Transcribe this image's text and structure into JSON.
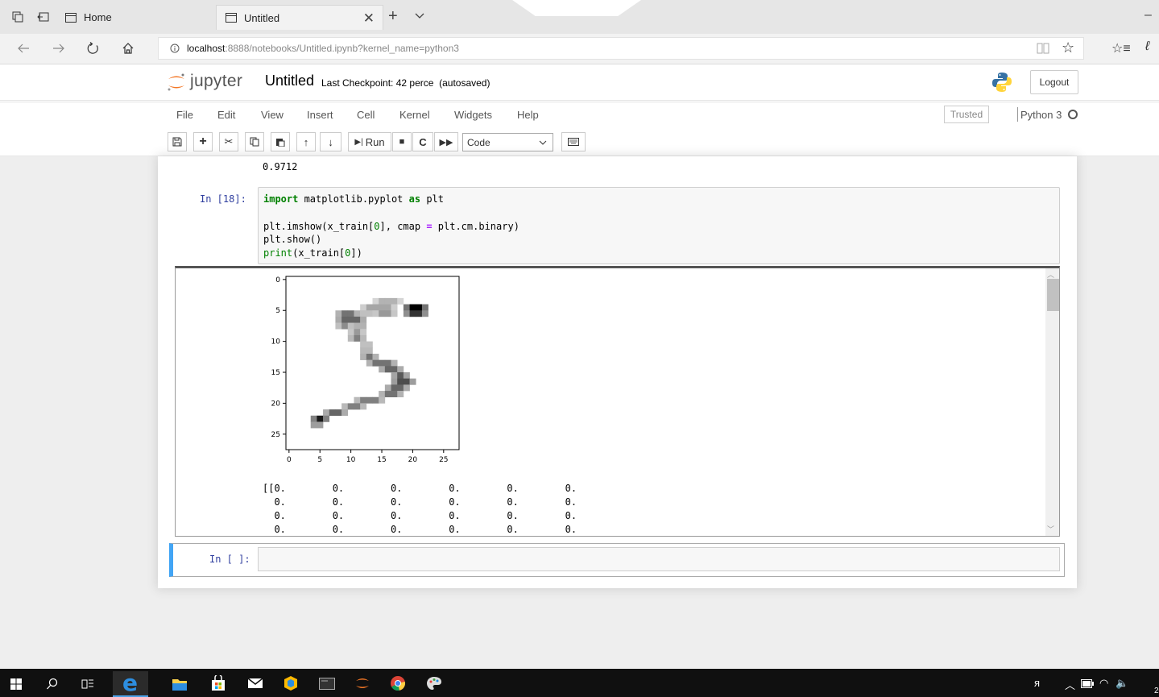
{
  "browser": {
    "tabs": [
      {
        "title": "Home"
      },
      {
        "title": "Untitled"
      }
    ],
    "url_host": "localhost",
    "url_path": ":8888/notebooks/Untitled.ipynb?kernel_name=python3"
  },
  "jupyter": {
    "logo_text": "jupyter",
    "notebook_title": "Untitled",
    "checkpoint_status": "Last Checkpoint: 42 perce",
    "autosave_status": "(autosaved)",
    "logout_label": "Logout",
    "menu": [
      "File",
      "Edit",
      "View",
      "Insert",
      "Cell",
      "Kernel",
      "Widgets",
      "Help"
    ],
    "trusted_label": "Trusted",
    "kernel_name": "Python 3",
    "toolbar": {
      "run_label": "Run",
      "cell_type": "Code"
    }
  },
  "cells": {
    "previous_output": "0.9712",
    "cell18": {
      "prompt": "In [18]:",
      "code_lines": [
        "import matplotlib.pyplot as plt",
        "",
        "plt.imshow(x_train[0], cmap = plt.cm.binary)",
        "plt.show()",
        "print(x_train[0])"
      ]
    },
    "empty_prompt": "In [ ]:",
    "array_output_lines": [
      "[[0.        0.        0.        0.        0.        0.",
      "  0.        0.        0.        0.        0.        0.",
      "  0.        0.        0.        0.        0.        0.",
      "  0.        0.        0.        0.        0.        0."
    ]
  },
  "chart_data": {
    "type": "heatmap",
    "title": "",
    "xlabel": "",
    "ylabel": "",
    "x_ticks": [
      "0",
      "5",
      "10",
      "15",
      "20",
      "25"
    ],
    "y_ticks": [
      "0",
      "5",
      "10",
      "15",
      "20",
      "25"
    ],
    "size": [
      28,
      28
    ],
    "colormap": "binary",
    "pixels": [
      [
        5,
        19,
        23,
        1.0
      ],
      [
        6,
        19,
        23,
        0.8
      ],
      [
        4,
        14,
        19,
        0.3
      ],
      [
        5,
        12,
        18,
        0.35
      ],
      [
        6,
        8,
        12,
        0.55
      ],
      [
        6,
        12,
        14,
        0.45
      ],
      [
        6,
        14,
        18,
        0.4
      ],
      [
        7,
        8,
        13,
        0.6
      ],
      [
        8,
        8,
        11,
        0.45
      ],
      [
        8,
        11,
        13,
        0.55
      ],
      [
        9,
        10,
        13,
        0.4
      ],
      [
        10,
        10,
        13,
        0.5
      ],
      [
        11,
        12,
        14,
        0.45
      ],
      [
        12,
        12,
        14,
        0.5
      ],
      [
        13,
        12,
        15,
        0.55
      ],
      [
        14,
        13,
        18,
        0.55
      ],
      [
        15,
        15,
        19,
        0.6
      ],
      [
        16,
        17,
        20,
        0.65
      ],
      [
        17,
        17,
        21,
        0.7
      ],
      [
        18,
        16,
        20,
        0.6
      ],
      [
        19,
        15,
        19,
        0.55
      ],
      [
        20,
        11,
        16,
        0.5
      ],
      [
        21,
        9,
        13,
        0.5
      ],
      [
        22,
        6,
        10,
        0.6
      ],
      [
        23,
        4,
        7,
        0.9
      ],
      [
        24,
        4,
        6,
        0.7
      ]
    ]
  }
}
